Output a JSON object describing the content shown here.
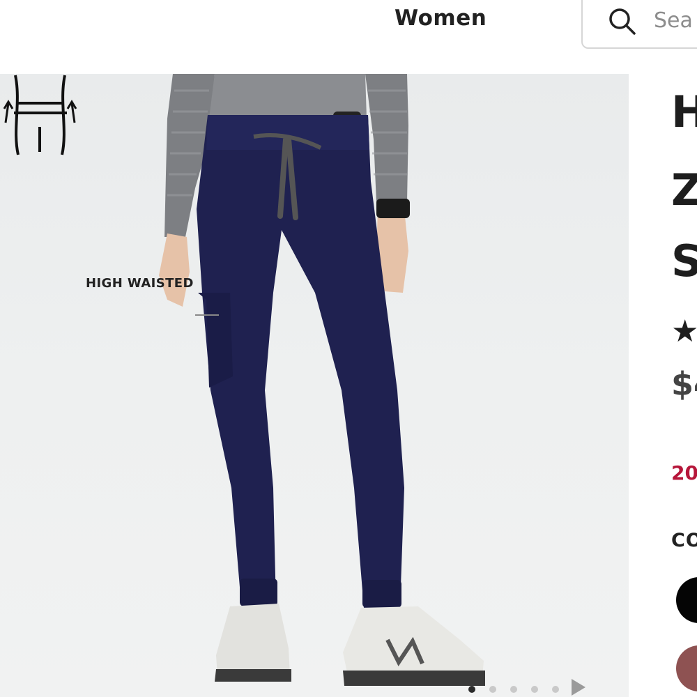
{
  "header": {
    "nav_women": "Women",
    "search_placeholder": "Sea"
  },
  "gallery": {
    "badge_label": "HIGH WAISTED",
    "badge_icon": "high-waisted-icon",
    "dots_total": 5,
    "active_dot": 1
  },
  "product": {
    "title_lines": [
      "H",
      "Z",
      "S"
    ],
    "rating": "★",
    "price": "$4",
    "promo": "20",
    "color_label": "CO",
    "swatches": [
      "#050505",
      "#8e5252"
    ]
  },
  "colors": {
    "pants": "#1f2150",
    "promo": "#b6163a"
  }
}
